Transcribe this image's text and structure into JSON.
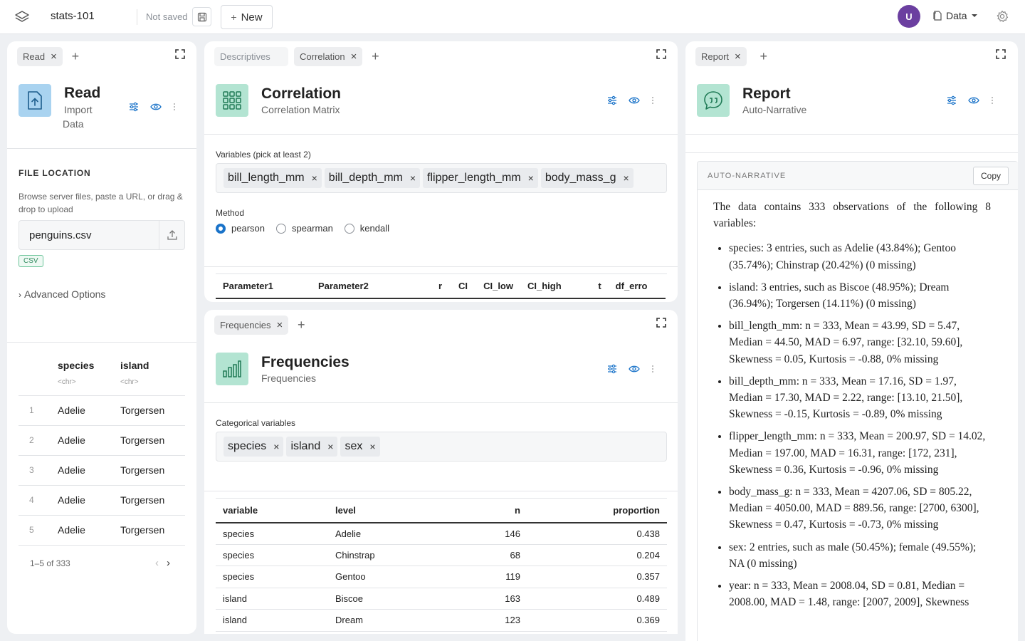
{
  "topbar": {
    "project_name": "stats-101",
    "save_status": "Not saved",
    "new_label": "New",
    "avatar_initial": "U",
    "data_menu_label": "Data"
  },
  "read_panel": {
    "tabs": [
      {
        "label": "Read"
      }
    ],
    "title": "Read",
    "subtitle_line1": "Import",
    "subtitle_line2": "Data",
    "section_title": "FILE LOCATION",
    "help_text": "Browse server files, paste a URL, or drag & drop to upload",
    "file_value": "penguins.csv",
    "badge": "CSV",
    "advanced_label": "Advanced Options",
    "columns": [
      {
        "name": "species",
        "type": "<chr>"
      },
      {
        "name": "island",
        "type": "<chr>"
      }
    ],
    "rows": [
      {
        "n": "1",
        "species": "Adelie",
        "island": "Torgersen"
      },
      {
        "n": "2",
        "species": "Adelie",
        "island": "Torgersen"
      },
      {
        "n": "3",
        "species": "Adelie",
        "island": "Torgersen"
      },
      {
        "n": "4",
        "species": "Adelie",
        "island": "Torgersen"
      },
      {
        "n": "5",
        "species": "Adelie",
        "island": "Torgersen"
      }
    ],
    "pager_text": "1–5 of 333"
  },
  "correlation_panel": {
    "tabs": [
      {
        "label": "Descriptives"
      },
      {
        "label": "Correlation"
      }
    ],
    "title": "Correlation",
    "subtitle": "Correlation Matrix",
    "variables_label": "Variables (pick at least 2)",
    "variables": [
      "bill_length_mm",
      "bill_depth_mm",
      "flipper_length_mm",
      "body_mass_g"
    ],
    "method_label": "Method",
    "methods": [
      {
        "label": "pearson",
        "selected": true
      },
      {
        "label": "spearman",
        "selected": false
      },
      {
        "label": "kendall",
        "selected": false
      }
    ],
    "table_headers": [
      "Parameter1",
      "Parameter2",
      "r",
      "CI",
      "CI_low",
      "CI_high",
      "t",
      "df_erro"
    ]
  },
  "frequencies_panel": {
    "tabs": [
      {
        "label": "Frequencies"
      }
    ],
    "title": "Frequencies",
    "subtitle": "Frequencies",
    "vars_label": "Categorical variables",
    "variables": [
      "species",
      "island",
      "sex"
    ],
    "headers": [
      "variable",
      "level",
      "n",
      "proportion"
    ],
    "rows": [
      [
        "species",
        "Adelie",
        "146",
        "0.438"
      ],
      [
        "species",
        "Chinstrap",
        "68",
        "0.204"
      ],
      [
        "species",
        "Gentoo",
        "119",
        "0.357"
      ],
      [
        "island",
        "Biscoe",
        "163",
        "0.489"
      ],
      [
        "island",
        "Dream",
        "123",
        "0.369"
      ]
    ]
  },
  "report_panel": {
    "tabs": [
      {
        "label": "Report"
      }
    ],
    "title": "Report",
    "subtitle": "Auto-Narrative",
    "narrative_label": "AUTO-NARRATIVE",
    "copy_label": "Copy",
    "intro": "The data contains 333 observations of the following 8 variables:",
    "items": [
      "species: 3 entries, such as Adelie (43.84%); Gentoo (35.74%); Chinstrap (20.42%) (0 missing)",
      "island: 3 entries, such as Biscoe (48.95%); Dream (36.94%); Torgersen (14.11%) (0 missing)",
      "bill_length_mm: n = 333, Mean = 43.99, SD = 5.47, Median = 44.50, MAD = 6.97, range: [32.10, 59.60], Skewness = 0.05, Kurtosis = -0.88, 0% missing",
      "bill_depth_mm: n = 333, Mean = 17.16, SD = 1.97, Median = 17.30, MAD = 2.22, range: [13.10, 21.50], Skewness = -0.15, Kurtosis = -0.89, 0% missing",
      "flipper_length_mm: n = 333, Mean = 200.97, SD = 14.02, Median = 197.00, MAD = 16.31, range: [172, 231], Skewness = 0.36, Kurtosis = -0.96, 0% missing",
      "body_mass_g: n = 333, Mean = 4207.06, SD = 805.22, Median = 4050.00, MAD = 889.56, range: [2700, 6300], Skewness = 0.47, Kurtosis = -0.73, 0% missing",
      "sex: 2 entries, such as male (50.45%); female (49.55%); NA (0 missing)",
      "year: n = 333, Mean = 2008.04, SD = 0.81, Median = 2008.00, MAD = 1.48, range: [2007, 2009], Skewness"
    ]
  },
  "colors": {
    "accent": "#1a73c9",
    "node_icon_bg": "#b3e4d2",
    "read_icon_bg": "#a9d3f0",
    "avatar": "#6b3fa0"
  }
}
